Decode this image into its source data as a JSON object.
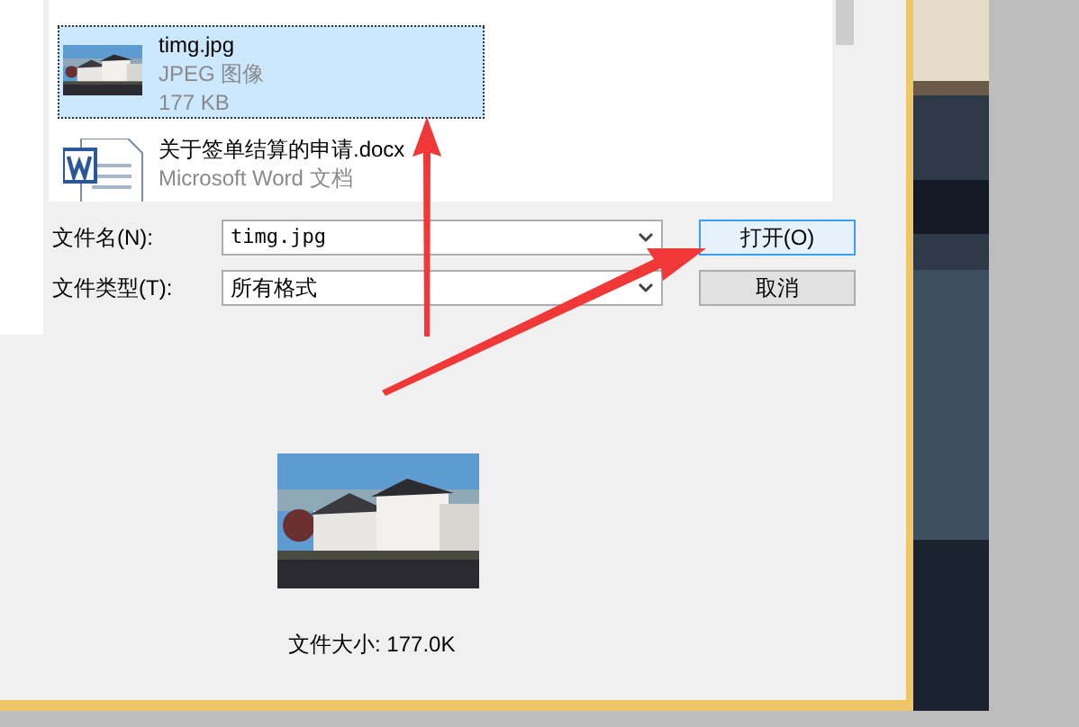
{
  "file_list": [
    {
      "name": "timg.jpg",
      "type": "JPEG 图像",
      "size": "177 KB",
      "selected": true
    },
    {
      "kind": "word",
      "name": "关于签单结算的申请.docx",
      "type": "Microsoft Word 文档",
      "selected": false
    }
  ],
  "filename": {
    "label": "文件名(N):",
    "value": "timg.jpg"
  },
  "filetype": {
    "label": "文件类型(T):",
    "value": "所有格式"
  },
  "buttons": [
    {
      "label": "打开(O)",
      "focused": true
    },
    {
      "label": "取消",
      "focused": false
    }
  ],
  "preview": {
    "size_text": "文件大小: 177.0K"
  }
}
